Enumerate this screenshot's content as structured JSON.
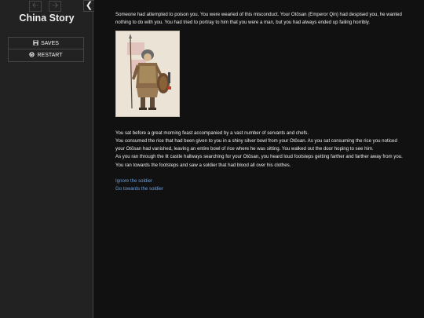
{
  "sidebar": {
    "title": "China Story",
    "menu": [
      {
        "label": "SAVES",
        "icon": "save-icon"
      },
      {
        "label": "RESTART",
        "icon": "restart-icon"
      }
    ]
  },
  "passage": {
    "intro": "Someone had attempted to poison you. You were wearied of this misconduct. Your Otōsan (Emperor Qin) had despised you, he wanted nothing to do with you. You had tried to portray to him that you were a man, but you had always ended up failing horribly.",
    "paragraphs": [
      "You sat before a great morning feast accompanied by a vast number of servants and chefs.",
      "You consumed the rice that had been given to you in a shiny silver bowl from your Otōsan. As you sat consuming the rice you noticed your Otōsan had vanished, leaving an entire bowl of rice where he was sitting. You walked out the door hoping to see him.",
      "As you ran through the lit castle hallways searching for your Otōsan, you heard loud footsteps getting farther and farther away from you. You ran towards the footsteps and saw a soldier that had blood all over his clothes."
    ],
    "choices": [
      "Ignore the soldier",
      "Go towards the soldier"
    ]
  }
}
